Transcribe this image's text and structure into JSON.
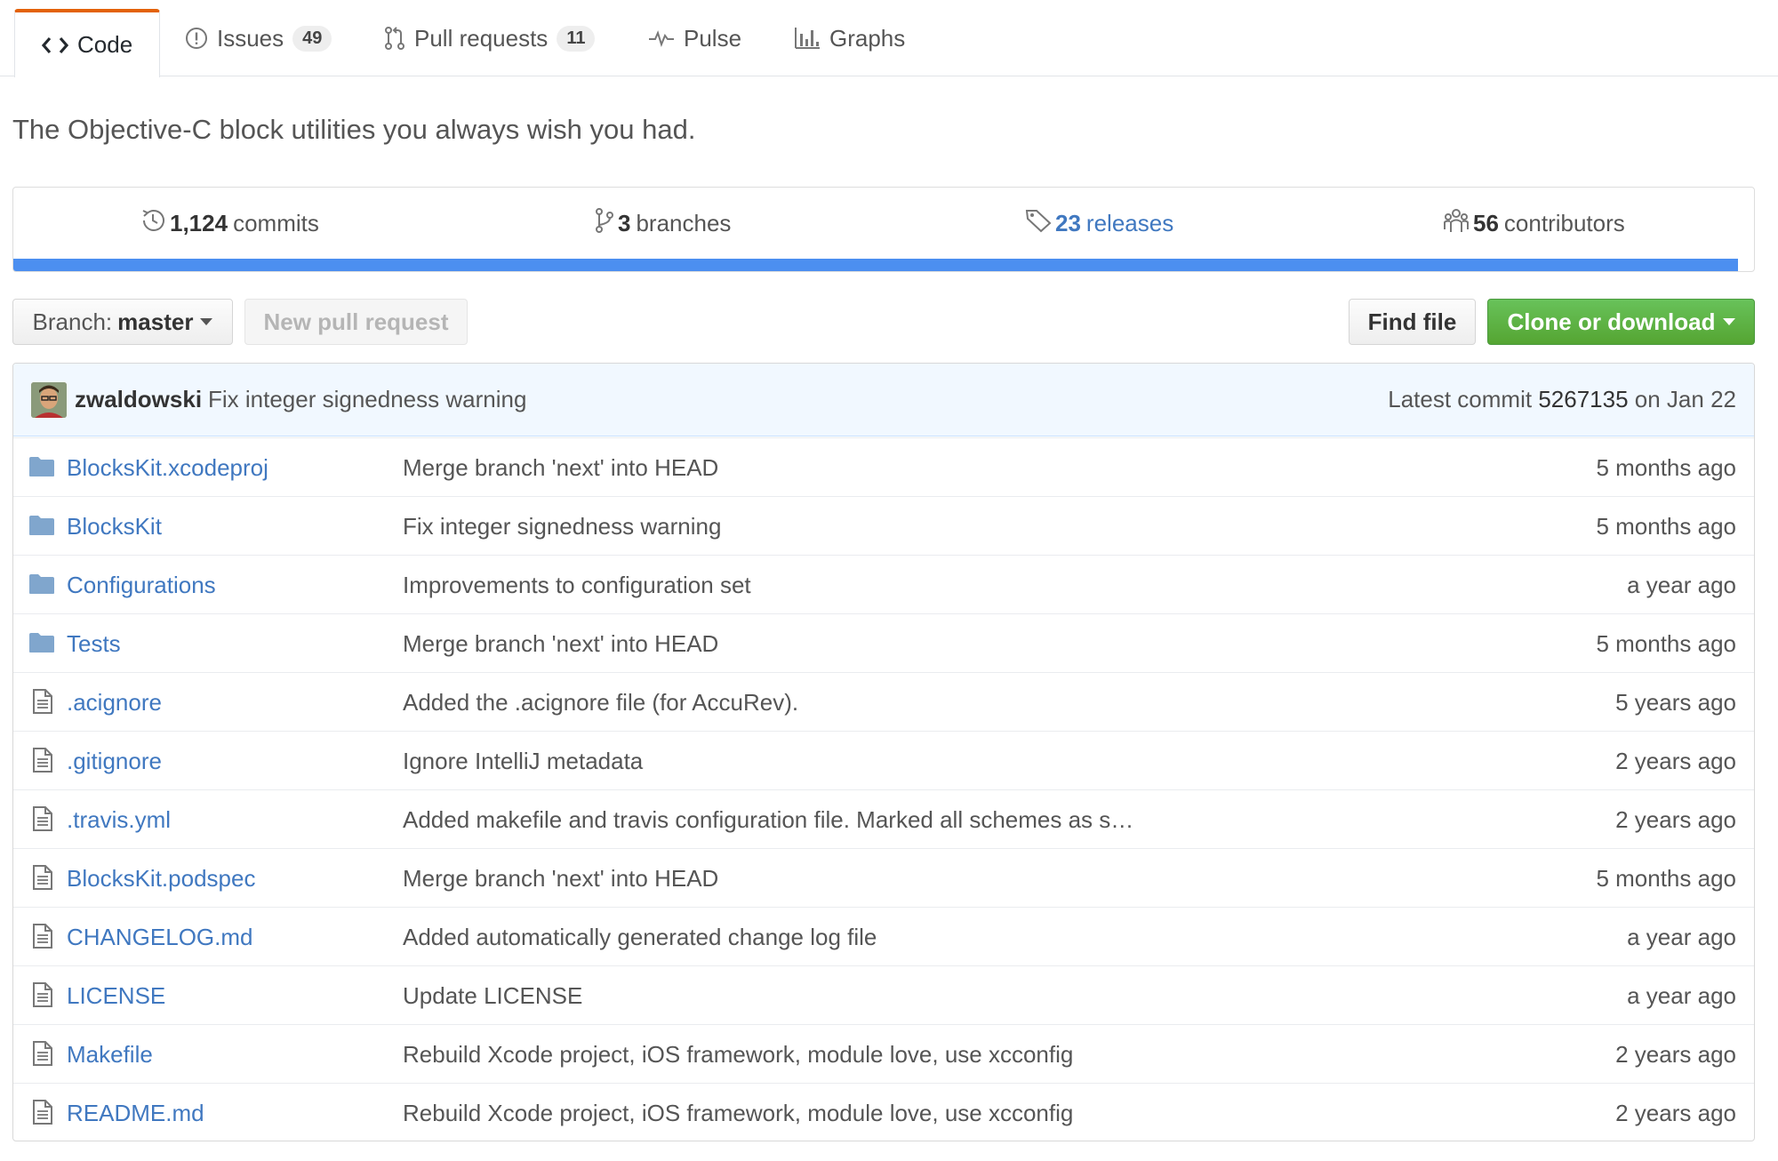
{
  "tabs": [
    {
      "label": "Code",
      "counter": null,
      "selected": true
    },
    {
      "label": "Issues",
      "counter": "49",
      "selected": false
    },
    {
      "label": "Pull requests",
      "counter": "11",
      "selected": false
    },
    {
      "label": "Pulse",
      "counter": null,
      "selected": false
    },
    {
      "label": "Graphs",
      "counter": null,
      "selected": false
    }
  ],
  "description": "The Objective-C block utilities you always wish you had.",
  "summary": {
    "commits": {
      "count": "1,124",
      "label": "commits"
    },
    "branches": {
      "count": "3",
      "label": "branches"
    },
    "releases": {
      "count": "23",
      "label": "releases"
    },
    "contributors": {
      "count": "56",
      "label": "contributors"
    }
  },
  "branch": {
    "prefix": "Branch:",
    "name": "master"
  },
  "buttons": {
    "new_pull_request": "New pull request",
    "find_file": "Find file",
    "clone": "Clone or download"
  },
  "latest_commit": {
    "author": "zwaldowski",
    "message": "Fix integer signedness warning",
    "prefix": "Latest commit",
    "sha": "5267135",
    "date": "on Jan 22"
  },
  "files": [
    {
      "type": "folder",
      "name": "BlocksKit.xcodeproj",
      "message": "Merge branch 'next' into HEAD",
      "age": "5 months ago"
    },
    {
      "type": "folder",
      "name": "BlocksKit",
      "message": "Fix integer signedness warning",
      "age": "5 months ago"
    },
    {
      "type": "folder",
      "name": "Configurations",
      "message": "Improvements to configuration set",
      "age": "a year ago"
    },
    {
      "type": "folder",
      "name": "Tests",
      "message": "Merge branch 'next' into HEAD",
      "age": "5 months ago"
    },
    {
      "type": "file",
      "name": ".acignore",
      "message": "Added the .acignore file (for AccuRev).",
      "age": "5 years ago"
    },
    {
      "type": "file",
      "name": ".gitignore",
      "message": "Ignore IntelliJ metadata",
      "age": "2 years ago"
    },
    {
      "type": "file",
      "name": ".travis.yml",
      "message": "Added makefile and travis configuration file. Marked all schemes as s…",
      "age": "2 years ago"
    },
    {
      "type": "file",
      "name": "BlocksKit.podspec",
      "message": "Merge branch 'next' into HEAD",
      "age": "5 months ago"
    },
    {
      "type": "file",
      "name": "CHANGELOG.md",
      "message": "Added automatically generated change log file",
      "age": "a year ago"
    },
    {
      "type": "file",
      "name": "LICENSE",
      "message": "Update LICENSE",
      "age": "a year ago"
    },
    {
      "type": "file",
      "name": "Makefile",
      "message": "Rebuild Xcode project, iOS framework, module love, use xcconfig",
      "age": "2 years ago"
    },
    {
      "type": "file",
      "name": "README.md",
      "message": "Rebuild Xcode project, iOS framework, module love, use xcconfig",
      "age": "2 years ago"
    }
  ],
  "colors": {
    "accent_tab": "#e36209",
    "link": "#4078c0",
    "language_bar": "#4c8ff0",
    "clone_button": "#55a532",
    "folder_icon": "#80a6cd",
    "commit_tease_bg": "#f1f8ff"
  }
}
